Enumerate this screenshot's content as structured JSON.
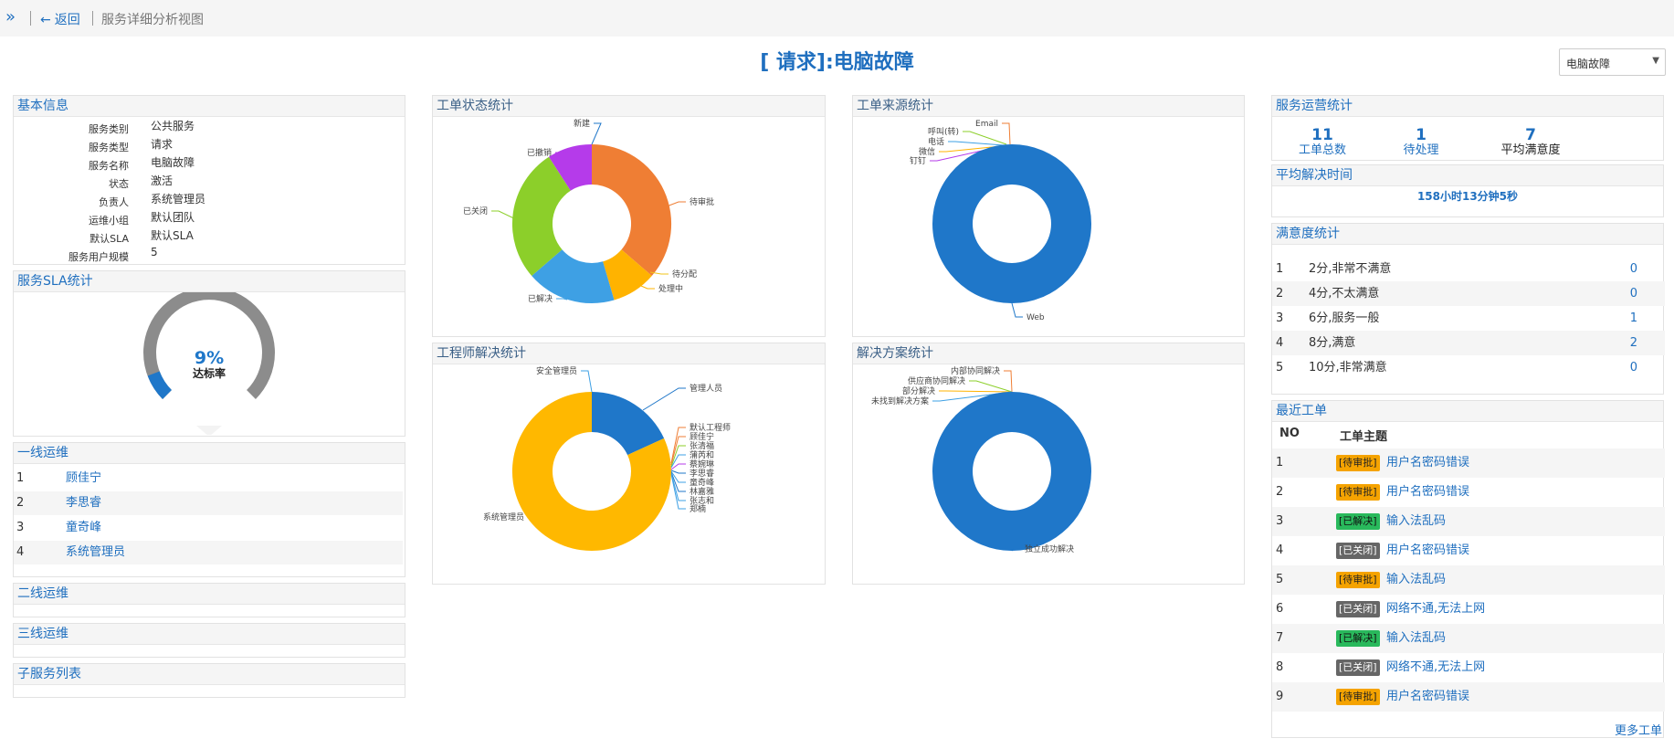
{
  "topbar": {
    "expand_icon": "double-chevron-right",
    "back_label": "返回",
    "breadcrumb": "服务详细分析视图"
  },
  "page": {
    "title": "[ 请求]:电脑故障",
    "select_value": "电脑故障"
  },
  "basic_info": {
    "title": "基本信息",
    "rows": [
      {
        "k": "服务类别",
        "v": "公共服务"
      },
      {
        "k": "服务类型",
        "v": "请求"
      },
      {
        "k": "服务名称",
        "v": "电脑故障"
      },
      {
        "k": "状态",
        "v": "激活"
      },
      {
        "k": "负责人",
        "v": "系统管理员"
      },
      {
        "k": "运维小组",
        "v": "默认团队"
      },
      {
        "k": "默认SLA",
        "v": "默认SLA"
      },
      {
        "k": "服务用户规模",
        "v": "5"
      }
    ]
  },
  "sla": {
    "title": "服务SLA统计",
    "value": "9%",
    "label": "达标率",
    "rate": 0.09,
    "colors": {
      "track": "#8c8c8c",
      "fill": "#1f77c9"
    }
  },
  "line1": {
    "title": "一线运维",
    "items": [
      {
        "n": "1",
        "name": "顾佳宁"
      },
      {
        "n": "2",
        "name": "李思睿"
      },
      {
        "n": "3",
        "name": "童奇峰"
      },
      {
        "n": "4",
        "name": "系统管理员"
      }
    ]
  },
  "line2": {
    "title": "二线运维"
  },
  "line3": {
    "title": "三线运维"
  },
  "sub_services": {
    "title": "子服务列表"
  },
  "charts": {
    "status": {
      "title": "工单状态统计",
      "labels": [
        "新建",
        "待审批",
        "待分配",
        "处理中",
        "已解决",
        "已关闭",
        "已撤销"
      ]
    },
    "source": {
      "title": "工单来源统计",
      "labels": [
        "Email",
        "呼叫(转)",
        "电话",
        "微信",
        "钉钉",
        "Web"
      ]
    },
    "engineer": {
      "title": "工程师解决统计",
      "labels": [
        "安全管理员",
        "管理人员",
        "默认工程师",
        "顾佳宁",
        "张清福",
        "蒲芮和",
        "蔡婉琳",
        "李思睿",
        "童奇峰",
        "林嘉雅",
        "张志和",
        "郑楠",
        "系统管理员"
      ]
    },
    "solution": {
      "title": "解决方案统计",
      "labels": [
        "内部协同解决",
        "供应商协同解决",
        "部分解决",
        "未找到解决方案",
        "独立成功解决"
      ]
    }
  },
  "chart_data": [
    {
      "type": "pie",
      "title": "工单状态统计",
      "categories": [
        "新建",
        "待审批",
        "待分配",
        "处理中",
        "已解决",
        "已关闭",
        "已撤销"
      ],
      "values": [
        0,
        4,
        0,
        1,
        2,
        3,
        1
      ],
      "colors": [
        "#1f77c9",
        "#ef7e34",
        "#f0c419",
        "#ffb300",
        "#3ea0e4",
        "#8ccf2a",
        "#b53bea"
      ]
    },
    {
      "type": "pie",
      "title": "工单来源统计",
      "categories": [
        "Email",
        "呼叫(转)",
        "电话",
        "微信",
        "钉钉",
        "Web"
      ],
      "values": [
        0,
        0,
        0,
        0,
        0,
        11
      ],
      "colors": [
        "#ef7e34",
        "#8ccf2a",
        "#3ea0e4",
        "#ffb300",
        "#b53bea",
        "#1f77c9"
      ]
    },
    {
      "type": "pie",
      "title": "工程师解决统计",
      "categories": [
        "安全管理员",
        "管理人员",
        "默认工程师",
        "顾佳宁",
        "张清福",
        "蒲芮和",
        "蔡婉琳",
        "李思睿",
        "童奇峰",
        "林嘉雅",
        "张志和",
        "郑楠",
        "系统管理员"
      ],
      "values": [
        0,
        2,
        0,
        0,
        0,
        0,
        0,
        0,
        0,
        0,
        0,
        0,
        9
      ],
      "colors": [
        "#3ea0e4",
        "#1f77c9",
        "#ef7e34",
        "#ef7e34",
        "#8ccf2a",
        "#3ea0e4",
        "#b53bea",
        "#1f77c9",
        "#3ea0e4",
        "#1f77c9",
        "#3ea0e4",
        "#3ea0e4",
        "#ffb800"
      ]
    },
    {
      "type": "pie",
      "title": "解决方案统计",
      "categories": [
        "内部协同解决",
        "供应商协同解决",
        "部分解决",
        "未找到解决方案",
        "独立成功解决"
      ],
      "values": [
        0,
        0,
        0,
        0,
        1
      ],
      "colors": [
        "#ef7e34",
        "#8ccf2a",
        "#ffb300",
        "#3ea0e4",
        "#1f77c9"
      ]
    }
  ],
  "ops": {
    "title": "服务运营统计",
    "stats": [
      {
        "num": "11",
        "label": "工单总数"
      },
      {
        "num": "1",
        "label": "待处理"
      },
      {
        "num": "7",
        "label": "平均满意度"
      }
    ]
  },
  "avg_time": {
    "title": "平均解决时间",
    "value": "158小时13分钟5秒"
  },
  "satisfaction": {
    "title": "满意度统计",
    "rows": [
      {
        "n": "1",
        "t": "2分,非常不满意",
        "c": "0"
      },
      {
        "n": "2",
        "t": "4分,不太满意",
        "c": "0"
      },
      {
        "n": "3",
        "t": "6分,服务一般",
        "c": "1"
      },
      {
        "n": "4",
        "t": "8分,满意",
        "c": "2"
      },
      {
        "n": "5",
        "t": "10分,非常满意",
        "c": "0"
      }
    ]
  },
  "recent": {
    "title": "最近工单",
    "col_no": "NO",
    "col_subject": "工单主题",
    "rows": [
      {
        "n": "1",
        "status": "[待审批]",
        "kind": "pending",
        "subject": "用户名密码错误"
      },
      {
        "n": "2",
        "status": "[待审批]",
        "kind": "pending",
        "subject": "用户名密码错误"
      },
      {
        "n": "3",
        "status": "[已解决]",
        "kind": "solved",
        "subject": "输入法乱码"
      },
      {
        "n": "4",
        "status": "[已关闭]",
        "kind": "closed",
        "subject": "用户名密码错误"
      },
      {
        "n": "5",
        "status": "[待审批]",
        "kind": "pending",
        "subject": "输入法乱码"
      },
      {
        "n": "6",
        "status": "[已关闭]",
        "kind": "closed",
        "subject": "网络不通,无法上网"
      },
      {
        "n": "7",
        "status": "[已解决]",
        "kind": "solved",
        "subject": "输入法乱码"
      },
      {
        "n": "8",
        "status": "[已关闭]",
        "kind": "closed",
        "subject": "网络不通,无法上网"
      },
      {
        "n": "9",
        "status": "[待审批]",
        "kind": "pending",
        "subject": "用户名密码错误"
      }
    ],
    "more": "更多工单"
  }
}
